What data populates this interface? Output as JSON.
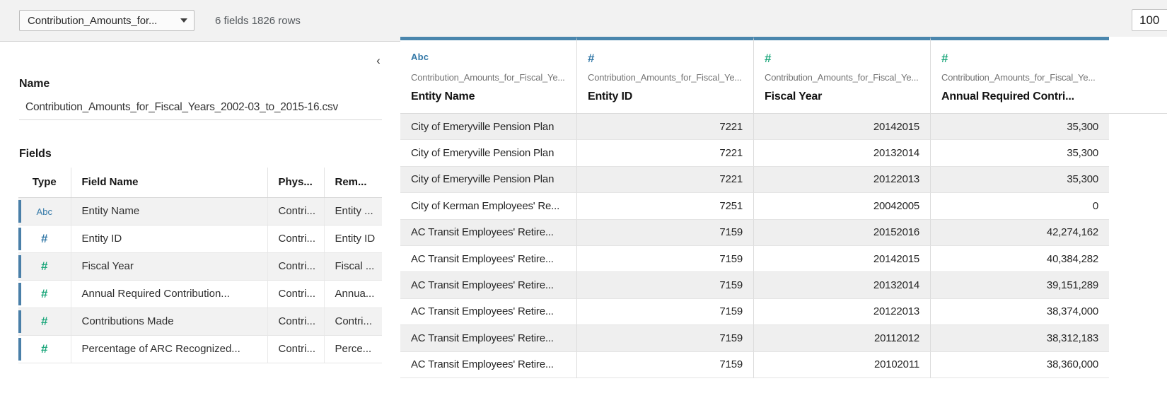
{
  "toolbar": {
    "datasource_name": "Contribution_Amounts_for...",
    "caret_icon": "chevron-down-icon",
    "meta_text": "6 fields 1826 rows",
    "row_limit_value": "100"
  },
  "left_panel": {
    "collapse_icon": "chevron-left-icon",
    "name_section_label": "Name",
    "name_value": "Contribution_Amounts_for_Fiscal_Years_2002-03_to_2015-16.csv",
    "fields_section_label": "Fields",
    "columns": [
      "Type",
      "Field Name",
      "Phys...",
      "Rem..."
    ],
    "rows": [
      {
        "type_icon": "Abc",
        "type_style": "abc",
        "field_name": "Entity Name",
        "physical": "Contri...",
        "remote": "Entity ..."
      },
      {
        "type_icon": "#",
        "type_style": "hash-blue",
        "field_name": "Entity ID",
        "physical": "Contri...",
        "remote": "Entity ID"
      },
      {
        "type_icon": "#",
        "type_style": "hash-green",
        "field_name": "Fiscal Year",
        "physical": "Contri...",
        "remote": "Fiscal ..."
      },
      {
        "type_icon": "#",
        "type_style": "hash-green",
        "field_name": "Annual Required Contribution...",
        "physical": "Contri...",
        "remote": "Annua..."
      },
      {
        "type_icon": "#",
        "type_style": "hash-green",
        "field_name": "Contributions Made",
        "physical": "Contri...",
        "remote": "Contri..."
      },
      {
        "type_icon": "#",
        "type_style": "hash-green",
        "field_name": "Percentage of ARC Recognized...",
        "physical": "Contri...",
        "remote": "Perce..."
      }
    ]
  },
  "data_grid": {
    "columns": [
      {
        "icon": "Abc",
        "icon_style": "abc",
        "source": "Contribution_Amounts_for_Fiscal_Ye...",
        "title": "Entity Name",
        "align": "left"
      },
      {
        "icon": "#",
        "icon_style": "hash-blue",
        "source": "Contribution_Amounts_for_Fiscal_Ye...",
        "title": "Entity ID",
        "align": "num"
      },
      {
        "icon": "#",
        "icon_style": "hash-green",
        "source": "Contribution_Amounts_for_Fiscal_Ye...",
        "title": "Fiscal Year",
        "align": "num"
      },
      {
        "icon": "#",
        "icon_style": "hash-green",
        "source": "Contribution_Amounts_for_Fiscal_Ye...",
        "title": "Annual Required Contri...",
        "align": "num"
      }
    ],
    "rows": [
      [
        "City of Emeryville Pension Plan",
        "7221",
        "20142015",
        "35,300"
      ],
      [
        "City of Emeryville Pension Plan",
        "7221",
        "20132014",
        "35,300"
      ],
      [
        "City of Emeryville Pension Plan",
        "7221",
        "20122013",
        "35,300"
      ],
      [
        "City of Kerman Employees' Re...",
        "7251",
        "20042005",
        "0"
      ],
      [
        "AC Transit Employees' Retire...",
        "7159",
        "20152016",
        "42,274,162"
      ],
      [
        "AC Transit Employees' Retire...",
        "7159",
        "20142015",
        "40,384,282"
      ],
      [
        "AC Transit Employees' Retire...",
        "7159",
        "20132014",
        "39,151,289"
      ],
      [
        "AC Transit Employees' Retire...",
        "7159",
        "20122013",
        "38,374,000"
      ],
      [
        "AC Transit Employees' Retire...",
        "7159",
        "20112012",
        "38,312,183"
      ],
      [
        "AC Transit Employees' Retire...",
        "7159",
        "20102011",
        "38,360,000"
      ]
    ]
  },
  "colors": {
    "accent_blue": "#4a86ad",
    "type_blue": "#3479a8",
    "type_green": "#1fa87d",
    "toolbar_bg": "#f2f2f2",
    "row_shade": "#efefef"
  }
}
